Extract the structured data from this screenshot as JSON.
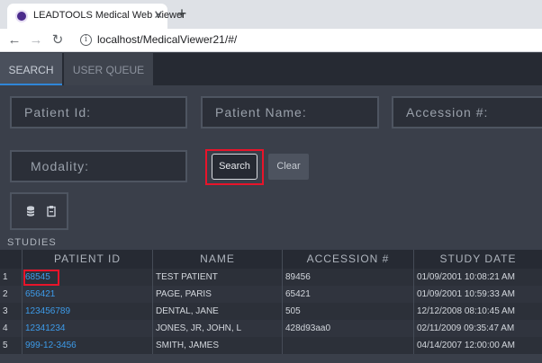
{
  "browser": {
    "tab_title": "LEADTOOLS Medical Web Viewer",
    "close_glyph": "✕",
    "new_tab_glyph": "+",
    "url": "localhost/MedicalViewer21/#/",
    "info_glyph": "i",
    "back_glyph": "←",
    "forward_glyph": "→",
    "reload_glyph": "↻"
  },
  "app_tabs": [
    {
      "label": "SEARCH",
      "active": true
    },
    {
      "label": "USER QUEUE",
      "active": false
    }
  ],
  "search_form": {
    "patient_id_placeholder": "Patient Id:",
    "patient_name_placeholder": "Patient Name:",
    "accession_placeholder": "Accession #:",
    "modality_placeholder": "Modality:",
    "search_label": "Search",
    "clear_label": "Clear"
  },
  "icons": [
    "database-icon",
    "clipboard-icon"
  ],
  "colors": {
    "accent": "#2f86d8",
    "link": "#3d9be9",
    "highlight": "#e8142a"
  },
  "studies": {
    "label": "STUDIES",
    "columns": [
      "",
      "PATIENT ID",
      "NAME",
      "ACCESSION #",
      "STUDY DATE"
    ],
    "rows": [
      {
        "index": "1",
        "patient_id": "68545",
        "name": "TEST PATIENT",
        "accession": "89456",
        "study_date": "01/09/2001 10:08:21 AM"
      },
      {
        "index": "2",
        "patient_id": "656421",
        "name": "PAGE, PARIS",
        "accession": "65421",
        "study_date": "01/09/2001 10:59:33 AM"
      },
      {
        "index": "3",
        "patient_id": "123456789",
        "name": "DENTAL, JANE",
        "accession": "505",
        "study_date": "12/12/2008 08:10:45 AM"
      },
      {
        "index": "4",
        "patient_id": "12341234",
        "name": "JONES, JR, JOHN, L",
        "accession": "428d93aa0",
        "study_date": "02/11/2009 09:35:47 AM"
      },
      {
        "index": "5",
        "patient_id": "999-12-3456",
        "name": "SMITH, JAMES",
        "accession": "",
        "study_date": "04/14/2007 12:00:00 AM"
      }
    ]
  }
}
